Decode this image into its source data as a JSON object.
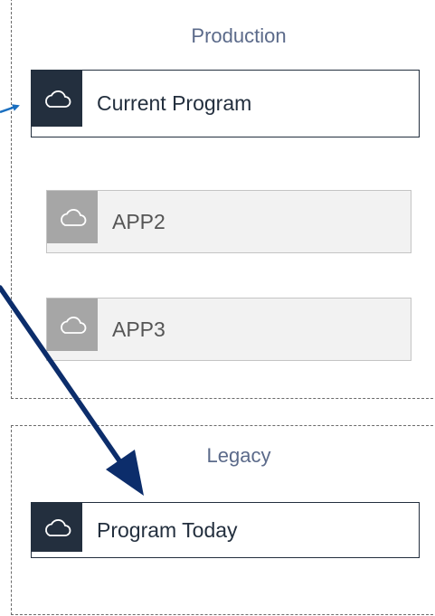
{
  "groups": {
    "production": {
      "title": "Production"
    },
    "legacy": {
      "title": "Legacy"
    }
  },
  "nodes": {
    "current_program": {
      "label": "Current Program",
      "state": "active"
    },
    "app2": {
      "label": "APP2",
      "state": "inactive"
    },
    "app3": {
      "label": "APP3",
      "state": "inactive"
    },
    "program_today": {
      "label": "Program Today",
      "state": "active"
    }
  },
  "colors": {
    "active_dark": "#232f3e",
    "inactive_gray": "#a6a6a6",
    "arrow_blue": "#0c2d6b",
    "title_slate": "#5b6a8a"
  },
  "icons": {
    "node_icon": "cloud-icon"
  }
}
